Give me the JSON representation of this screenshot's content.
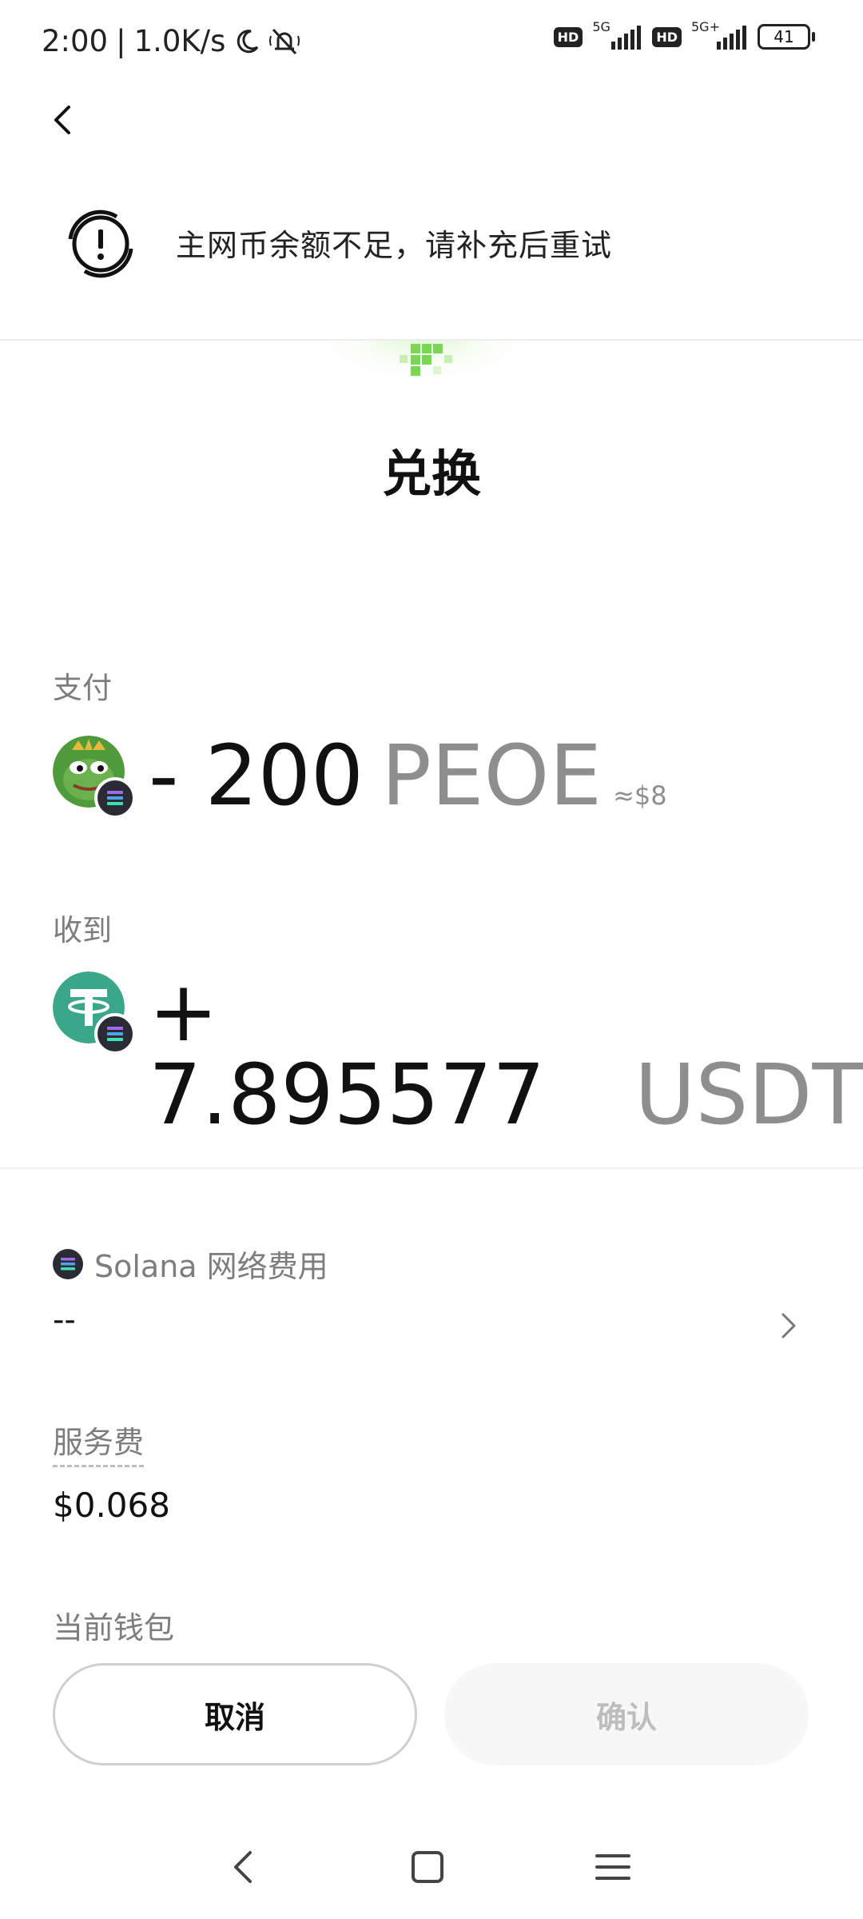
{
  "status_bar": {
    "time": "2:00",
    "speed": "1.0K/s",
    "sim1_hd": "HD",
    "sim1_net": "5G",
    "sim2_hd": "HD",
    "sim2_net": "5G+",
    "battery": "41"
  },
  "toast": {
    "message": "主网币余额不足，请补充后重试",
    "icon": "alert-refresh-icon"
  },
  "title": "兑换",
  "pay": {
    "label": "支付",
    "amount": "- 200",
    "symbol": "PEOE",
    "usd": "≈$8",
    "token_icon": "pepe-avatar"
  },
  "receive": {
    "label": "收到",
    "amount": "+ 7.895577",
    "symbol": "USDT",
    "token_icon": "tether-icon"
  },
  "network_fee": {
    "label": "Solana 网络费用",
    "value": "--"
  },
  "service_fee": {
    "label": "服务费",
    "value": "$0.068"
  },
  "wallet": {
    "label": "当前钱包"
  },
  "buttons": {
    "cancel": "取消",
    "confirm": "确认"
  },
  "colors": {
    "tether": "#3aa68a",
    "solana_badge": "#2b2b35",
    "muted_text": "#8e8e8e",
    "brand_green": "#7bd655"
  }
}
